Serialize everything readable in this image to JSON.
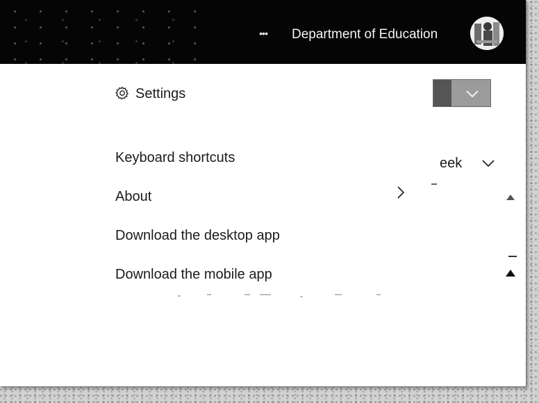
{
  "header": {
    "more_label": "•••",
    "org_name": "Department of Education"
  },
  "menu": {
    "settings_label": "Settings",
    "items": [
      {
        "label": "Keyboard shortcuts"
      },
      {
        "label": "About"
      },
      {
        "label": "Download the desktop app"
      },
      {
        "label": "Download the mobile app"
      }
    ]
  },
  "background": {
    "week_label": "eek"
  },
  "icons": {
    "gear": "gear-icon",
    "chevron_right": "chevron-right-icon",
    "chevron_down": "chevron-down-icon",
    "avatar": "avatar"
  },
  "colors": {
    "topbar": "#050505",
    "menu_bg": "#ffffff",
    "text": "#1b1b1b"
  }
}
